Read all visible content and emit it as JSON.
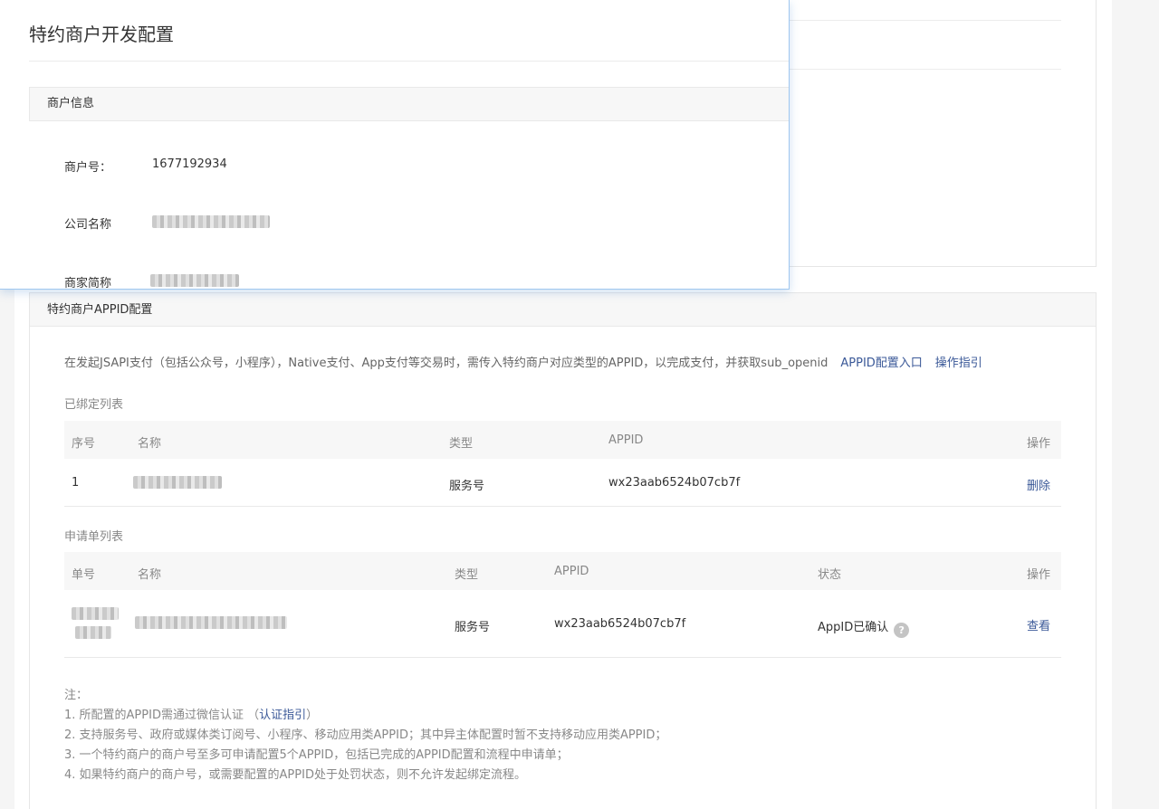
{
  "dialog": {
    "title": "特约商户开发配置",
    "section_title": "商户信息",
    "fields": [
      {
        "label": "商户号：",
        "value": "1677192934"
      },
      {
        "label": "公司名称",
        "value": ""
      },
      {
        "label": "商家简称",
        "value": ""
      }
    ]
  },
  "appid_panel": {
    "title": "特约商户APPID配置",
    "description": "在发起JSAPI支付（包括公众号，小程序），Native支付、App支付等交易时，需传入特约商户对应类型的APPID，以完成支付，并获取sub_openid",
    "link_config": "APPID配置入口",
    "link_guide": "操作指引",
    "bound_title": "已绑定列表",
    "bound_columns": [
      "序号",
      "名称",
      "类型",
      "APPID",
      "操作"
    ],
    "bound_rows": [
      {
        "index": "1",
        "name": "",
        "type": "服务号",
        "appid": "wx23aab6524b07cb7f",
        "action": "删除"
      }
    ],
    "apply_title": "申请单列表",
    "apply_columns": [
      "单号",
      "名称",
      "类型",
      "APPID",
      "状态",
      "操作"
    ],
    "apply_rows": [
      {
        "no": "",
        "name": "",
        "type": "服务号",
        "appid": "wx23aab6524b07cb7f",
        "status": "AppID已确认",
        "action": "查看"
      }
    ],
    "help_icon_glyph": "?",
    "notes": {
      "heading": "注：",
      "line1_prefix": "1. 所配置的APPID需通过微信认证 （",
      "line1_link": "认证指引",
      "line1_suffix": "）",
      "line2": "2. 支持服务号、政府或媒体类订阅号、小程序、移动应用类APPID；其中异主体配置时暂不支持移动应用类APPID；",
      "line3": "3. 一个特约商户的商户号至多可申请配置5个APPID，包括已完成的APPID配置和流程中申请单；",
      "line4": "4. 如果特约商户的商户号，或需要配置的APPID处于处罚状态，则不允许发起绑定流程。"
    }
  }
}
